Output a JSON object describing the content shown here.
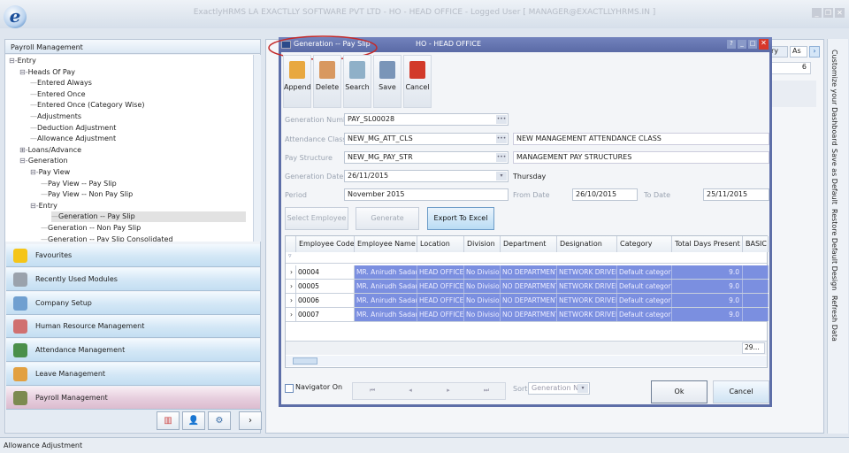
{
  "app": {
    "title": "ExactlyHRMS  LA EXACTLLY SOFTWARE PVT LTD - HO  - HEAD OFFICE - Logged User [ MANAGER@EXACTLLYHRMS.IN ]",
    "logo": "e"
  },
  "left_panel": {
    "title": "Payroll Management",
    "tree": [
      {
        "label": "Entry",
        "level": 0,
        "toggle": "−"
      },
      {
        "label": "Heads Of Pay",
        "level": 1,
        "toggle": "−"
      },
      {
        "label": "Entered Always",
        "level": 2
      },
      {
        "label": "Entered Once",
        "level": 2
      },
      {
        "label": "Entered Once (Category Wise)",
        "level": 2
      },
      {
        "label": "Adjustments",
        "level": 2
      },
      {
        "label": "Deduction Adjustment",
        "level": 2
      },
      {
        "label": "Allowance Adjustment",
        "level": 2
      },
      {
        "label": "Loans/Advance",
        "level": 1,
        "toggle": "+"
      },
      {
        "label": "Generation",
        "level": 1,
        "toggle": "−"
      },
      {
        "label": "Pay View",
        "level": 2,
        "toggle": "−"
      },
      {
        "label": "Pay View -- Pay Slip",
        "level": 3
      },
      {
        "label": "Pay View -- Non Pay Slip",
        "level": 3
      },
      {
        "label": "Entry",
        "level": 2,
        "toggle": "−"
      },
      {
        "label": "Generation -- Pay Slip",
        "level": 3,
        "selected": true
      },
      {
        "label": "Generation -- Non Pay Slip",
        "level": 3
      },
      {
        "label": "Generation -- Pay Slip Consolidated",
        "level": 3
      }
    ],
    "nav": [
      {
        "label": "Favourites",
        "icon": "star-icon",
        "color": "#f5c518"
      },
      {
        "label": "Recently Used Modules",
        "icon": "clipboard-icon",
        "color": "#9aa2ac"
      },
      {
        "label": "Company Setup",
        "icon": "company-icon",
        "color": "#6f9fd0"
      },
      {
        "label": "Human Resource Management",
        "icon": "people-icon",
        "color": "#d07070"
      },
      {
        "label": "Attendance Management",
        "icon": "clock-icon",
        "color": "#4a8f4a"
      },
      {
        "label": "Leave Management",
        "icon": "calendar-icon",
        "color": "#e2a040"
      },
      {
        "label": "Payroll Management",
        "icon": "payroll-icon",
        "color": "#7c8a50",
        "active": true
      }
    ],
    "more": "›"
  },
  "status": {
    "text": "Allowance Adjustment"
  },
  "right_bar": [
    "Customize your Dashboard",
    "Save as Default",
    "Restore Default Design",
    "Refresh Data"
  ],
  "background": {
    "tab1": "ry",
    "tab2": "As",
    "spinner": "6"
  },
  "dialog": {
    "title": "Generation -- Pay Slip",
    "office": "HO  - HEAD OFFICE",
    "toolbar": [
      {
        "label": "Append",
        "icon": "append-icon",
        "color": "#e8a840"
      },
      {
        "label": "Delete",
        "icon": "delete-icon",
        "color": "#d89860"
      },
      {
        "label": "Search",
        "icon": "search-icon",
        "color": "#8fb0c8"
      },
      {
        "label": "Save",
        "icon": "save-icon",
        "color": "#7a95b8"
      },
      {
        "label": "Cancel",
        "icon": "cancel-icon",
        "color": "#d23a2a"
      }
    ],
    "form": {
      "gen_no_label": "Generation Number",
      "gen_no": "PAY_SL00028",
      "att_label": "Attendance Class",
      "att_code": "NEW_MG_ATT_CLS",
      "att_desc": "NEW MANAGEMENT ATTENDANCE CLASS",
      "pay_label": "Pay Structure",
      "pay_code": "NEW_MG_PAY_STR",
      "pay_desc": "MANAGEMENT PAY STRUCTURES",
      "date_label": "Generation Date",
      "date": "26/11/2015",
      "day": "Thursday",
      "period_label": "Period",
      "period": "November 2015",
      "from_label": "From Date",
      "from": "26/10/2015",
      "to_label": "To Date",
      "to": "25/11/2015"
    },
    "buttons": {
      "select": "Select Employee",
      "generate": "Generate",
      "export": "Export To Excel"
    },
    "grid": {
      "columns": [
        "Employee Code",
        "Employee Name",
        "Location",
        "Division",
        "Department",
        "Designation",
        "Category",
        "Total Days Present",
        "BASIC S"
      ],
      "rows": [
        [
          "00004",
          "MR. Anirudh Sadani",
          "HEAD OFFICE",
          "No Division",
          "NO DEPARTMENT",
          "NETWORK DRIVER",
          "Default category",
          "9.0",
          ""
        ],
        [
          "00005",
          "MR. Anirudh Sadani",
          "HEAD OFFICE",
          "No Division",
          "NO DEPARTMENT",
          "NETWORK DRIVER",
          "Default category",
          "9.0",
          ""
        ],
        [
          "00006",
          "MR. Anirudh Sadani",
          "HEAD OFFICE",
          "No Division",
          "NO DEPARTMENT",
          "NETWORK DRIVER",
          "Default category",
          "9.0",
          ""
        ],
        [
          "00007",
          "MR. Anirudh Sadani",
          "HEAD OFFICE",
          "No Division",
          "NO DEPARTMENT",
          "NETWORK DRIVER",
          "Default category",
          "9.0",
          ""
        ]
      ],
      "footer_total": "29..."
    },
    "bottom": {
      "navigator": "Navigator On",
      "sort_label": "Sort",
      "sort_value": "Generation N...",
      "ok": "Ok",
      "cancel": "Cancel",
      "nav_first": "⏮",
      "nav_prev": "◂",
      "nav_next": "▸",
      "nav_last": "⏭"
    }
  },
  "colors": {
    "dialog_frame": "#5d6ea8",
    "selection": "#7b8fe0",
    "active_nav": "#e6cddd"
  }
}
